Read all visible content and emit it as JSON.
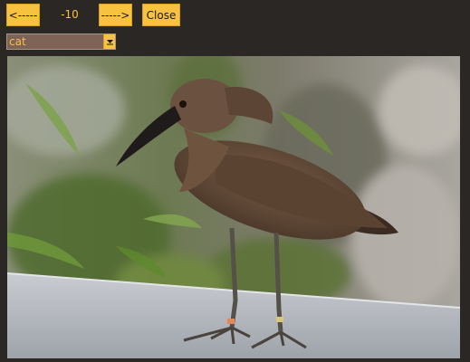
{
  "nav": {
    "prev_label": "<-----",
    "counter": "-10",
    "next_label": "----->",
    "close_label": "Close"
  },
  "select": {
    "value": "cat"
  },
  "image": {
    "subject": "bird-photo"
  },
  "colors": {
    "background": "#2b2725",
    "accent": "#f7c23f",
    "select_bg": "#7d6456"
  }
}
